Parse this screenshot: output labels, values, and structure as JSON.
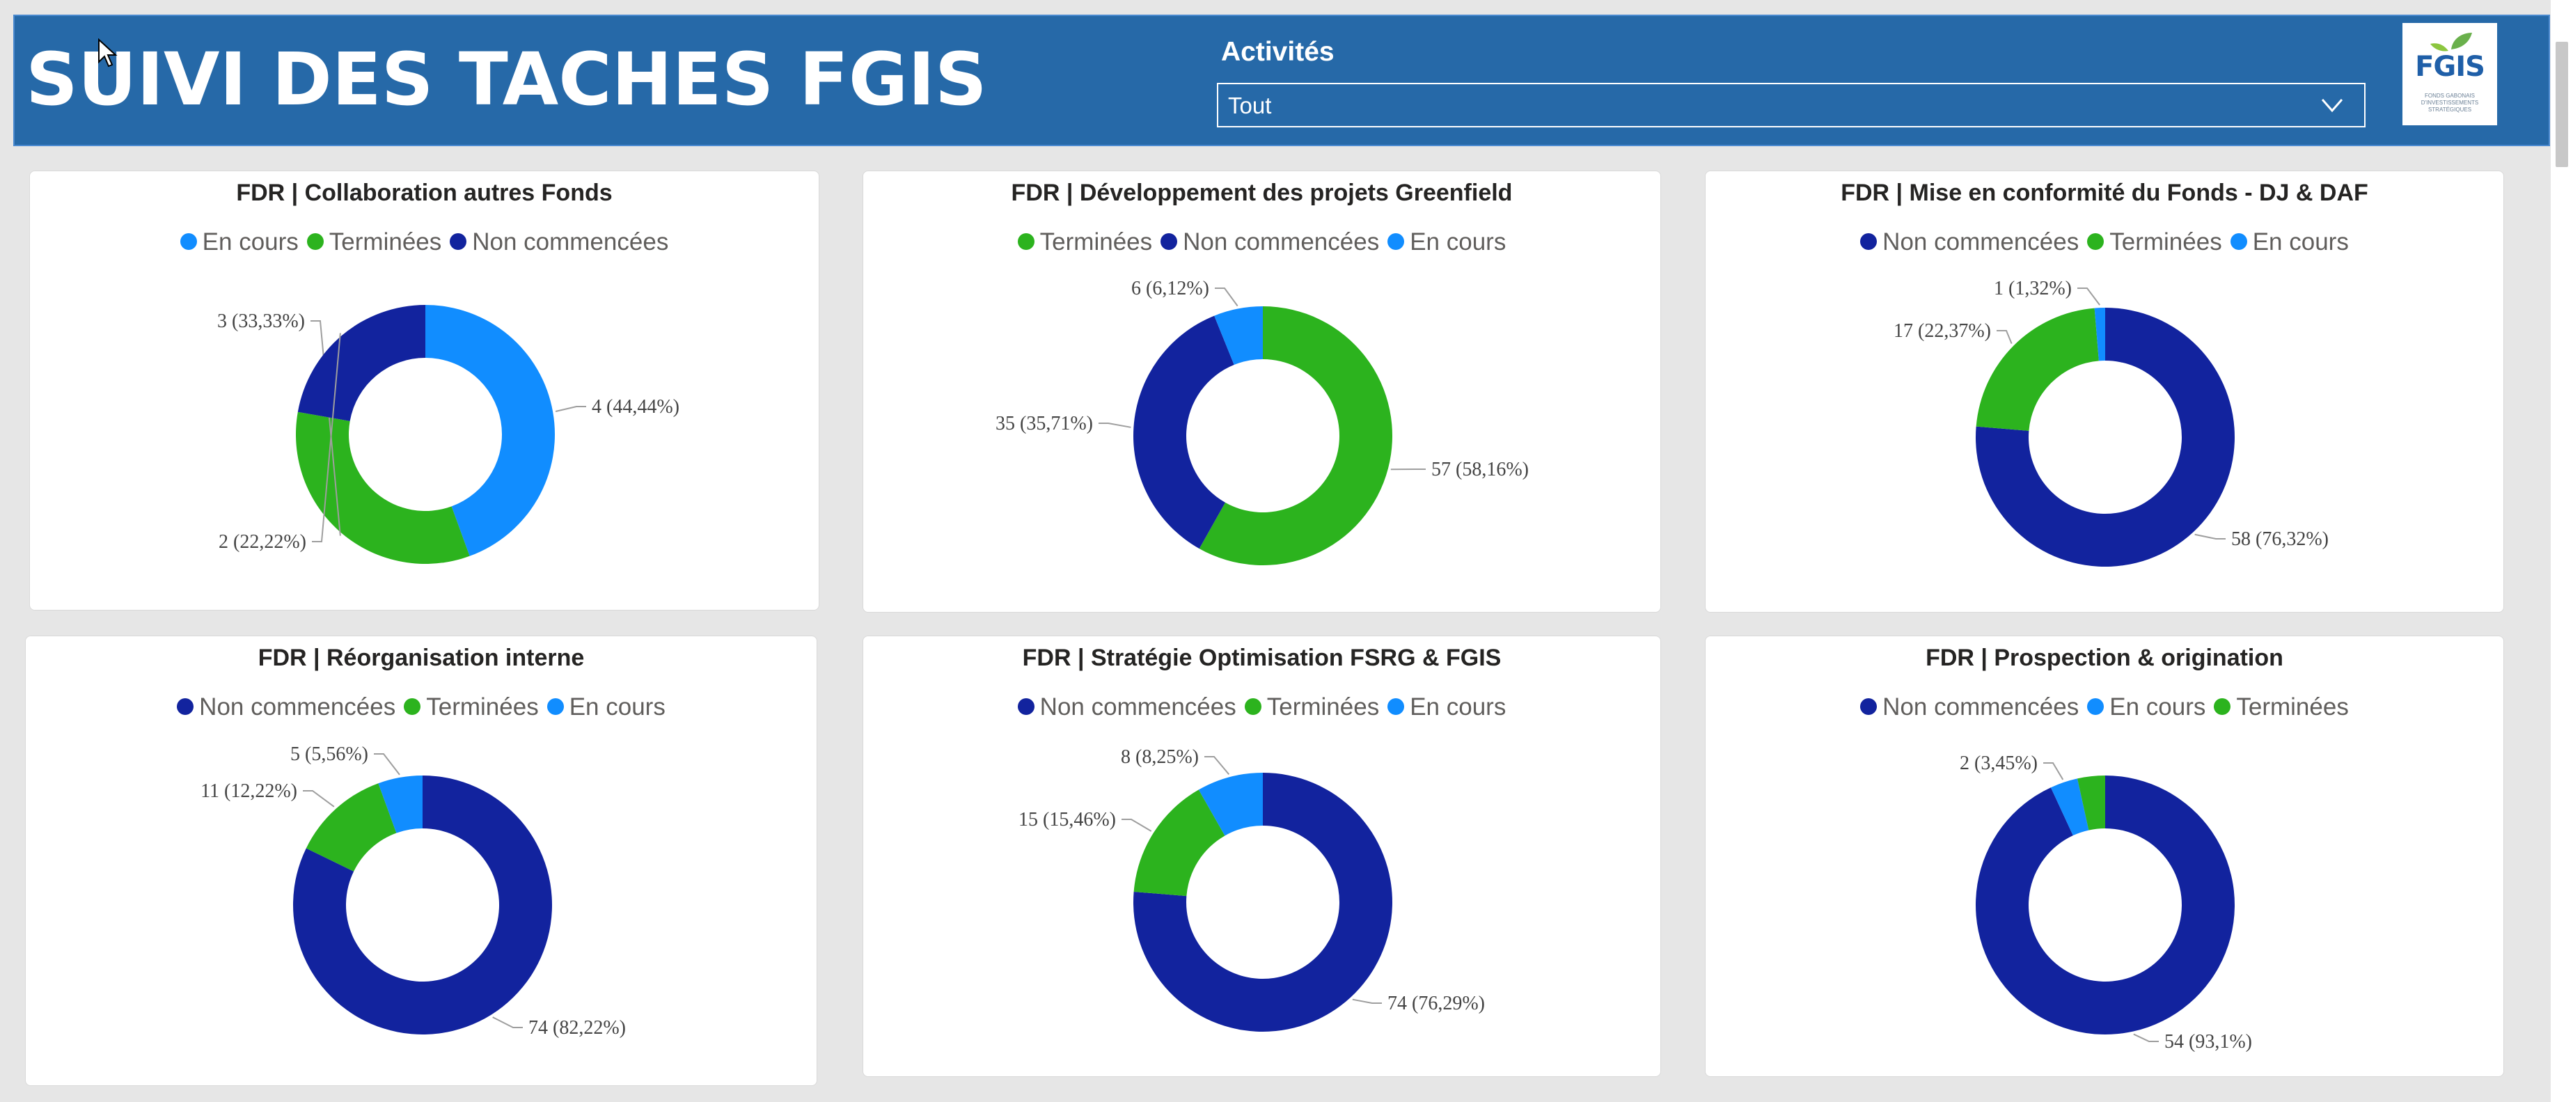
{
  "header": {
    "title": "SUIVI DES TACHES FGIS",
    "slicer_label": "Activités",
    "slicer_value": "Tout",
    "logo_text": "FGIS",
    "logo_subtitle": "FONDS GABONAIS D'INVESTISSEMENTS STRATÉGIQUES"
  },
  "colors": {
    "header_bg": "#2669a8",
    "en_cours": "#118dff",
    "terminees": "#2cb31e",
    "non_commencees": "#12239e"
  },
  "legend_labels": {
    "en_cours": "En cours",
    "terminees": "Terminées",
    "non_commencees": "Non commencées"
  },
  "charts": [
    {
      "title": "FDR | Collaboration autres Fonds",
      "legend": [
        {
          "key": "en_cours",
          "label": "En cours"
        },
        {
          "key": "terminees",
          "label": "Terminées"
        },
        {
          "key": "non_commencees",
          "label": "Non commencées"
        }
      ],
      "slices": [
        {
          "key": "en_cours",
          "label": "4 (44,44%)",
          "value": 4
        },
        {
          "key": "terminees",
          "label": "3 (33,33%)",
          "value": 3
        },
        {
          "key": "non_commencees",
          "label": "2 (22,22%)",
          "value": 2
        }
      ]
    },
    {
      "title": "FDR | Développement des projets Greenfield",
      "legend": [
        {
          "key": "terminees",
          "label": "Terminées"
        },
        {
          "key": "non_commencees",
          "label": "Non commencées"
        },
        {
          "key": "en_cours",
          "label": "En cours"
        }
      ],
      "slices": [
        {
          "key": "terminees",
          "label": "57 (58,16%)",
          "value": 57
        },
        {
          "key": "non_commencees",
          "label": "35 (35,71%)",
          "value": 35
        },
        {
          "key": "en_cours",
          "label": "6 (6,12%)",
          "value": 6
        }
      ]
    },
    {
      "title": "FDR | Mise en conformité du Fonds - DJ & DAF",
      "legend": [
        {
          "key": "non_commencees",
          "label": "Non commencées"
        },
        {
          "key": "terminees",
          "label": "Terminées"
        },
        {
          "key": "en_cours",
          "label": "En cours"
        }
      ],
      "slices": [
        {
          "key": "non_commencees",
          "label": "58 (76,32%)",
          "value": 58
        },
        {
          "key": "terminees",
          "label": "17 (22,37%)",
          "value": 17
        },
        {
          "key": "en_cours",
          "label": "1 (1,32%)",
          "value": 1
        }
      ]
    },
    {
      "title": "FDR | Réorganisation interne",
      "legend": [
        {
          "key": "non_commencees",
          "label": "Non commencées"
        },
        {
          "key": "terminees",
          "label": "Terminées"
        },
        {
          "key": "en_cours",
          "label": "En cours"
        }
      ],
      "slices": [
        {
          "key": "non_commencees",
          "label": "74 (82,22%)",
          "value": 74
        },
        {
          "key": "terminees",
          "label": "11 (12,22%)",
          "value": 11
        },
        {
          "key": "en_cours",
          "label": "5 (5,56%)",
          "value": 5
        }
      ]
    },
    {
      "title": "FDR | Stratégie Optimisation FSRG & FGIS",
      "legend": [
        {
          "key": "non_commencees",
          "label": "Non commencées"
        },
        {
          "key": "terminees",
          "label": "Terminées"
        },
        {
          "key": "en_cours",
          "label": "En cours"
        }
      ],
      "slices": [
        {
          "key": "non_commencees",
          "label": "74 (76,29%)",
          "value": 74
        },
        {
          "key": "terminees",
          "label": "15 (15,46%)",
          "value": 15
        },
        {
          "key": "en_cours",
          "label": "8 (8,25%)",
          "value": 8
        }
      ]
    },
    {
      "title": "FDR | Prospection & origination",
      "legend": [
        {
          "key": "non_commencees",
          "label": "Non commencées"
        },
        {
          "key": "en_cours",
          "label": "En cours"
        },
        {
          "key": "terminees",
          "label": "Terminées"
        }
      ],
      "slices": [
        {
          "key": "non_commencees",
          "label": "54 (93,1%)",
          "value": 54
        },
        {
          "key": "en_cours",
          "label": "2 (3,45%)",
          "value": 2
        },
        {
          "key": "terminees",
          "label": "",
          "value": 2
        }
      ]
    }
  ],
  "chart_data": [
    {
      "type": "pie",
      "title": "FDR | Collaboration autres Fonds",
      "categories": [
        "En cours",
        "Terminées",
        "Non commencées"
      ],
      "values": [
        4,
        3,
        2
      ]
    },
    {
      "type": "pie",
      "title": "FDR | Développement des projets Greenfield",
      "categories": [
        "Terminées",
        "Non commencées",
        "En cours"
      ],
      "values": [
        57,
        35,
        6
      ]
    },
    {
      "type": "pie",
      "title": "FDR | Mise en conformité du Fonds - DJ & DAF",
      "categories": [
        "Non commencées",
        "Terminées",
        "En cours"
      ],
      "values": [
        58,
        17,
        1
      ]
    },
    {
      "type": "pie",
      "title": "FDR | Réorganisation interne",
      "categories": [
        "Non commencées",
        "Terminées",
        "En cours"
      ],
      "values": [
        74,
        11,
        5
      ]
    },
    {
      "type": "pie",
      "title": "FDR | Stratégie Optimisation FSRG & FGIS",
      "categories": [
        "Non commencées",
        "Terminées",
        "En cours"
      ],
      "values": [
        74,
        15,
        8
      ]
    },
    {
      "type": "pie",
      "title": "FDR | Prospection & origination",
      "categories": [
        "Non commencées",
        "En cours",
        "Terminées"
      ],
      "values": [
        54,
        2,
        2
      ]
    }
  ]
}
